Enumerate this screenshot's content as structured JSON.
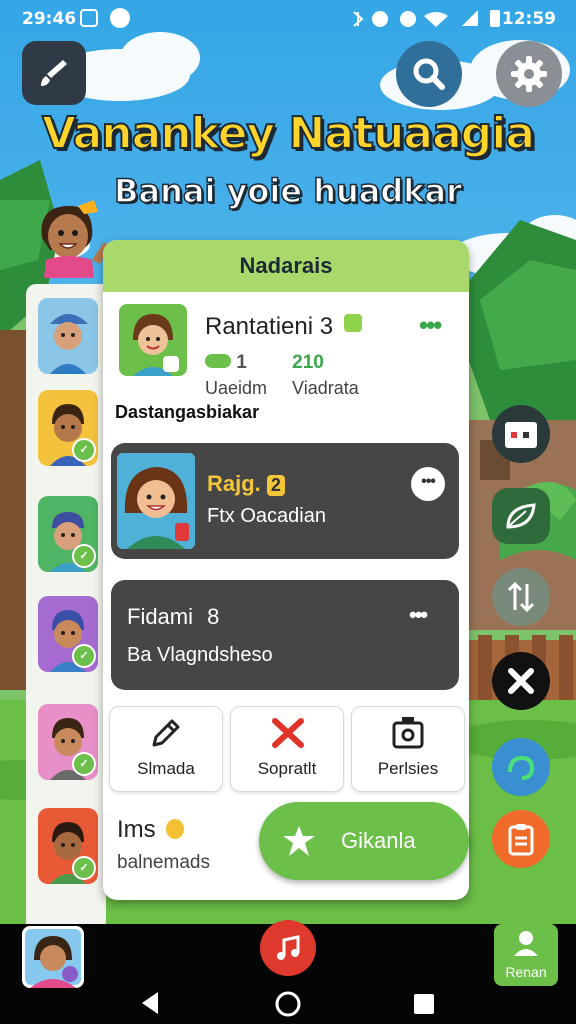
{
  "status_bar": {
    "time": "29:46",
    "clock": "12:59"
  },
  "header": {
    "title": "Vanankey Natuaagia",
    "subtitle": "Banai yoie huadkar"
  },
  "panel": {
    "header": "Nadarais",
    "profile": {
      "name": "Rantatieni 3",
      "stat_a_value": "1",
      "stat_b_value": "210",
      "stat_a_label": "Uaeidm",
      "stat_b_label": "Viadrata",
      "more": "•••"
    },
    "section_label": "Dastangasbiakar",
    "card1": {
      "title": "Rajg.",
      "badge": "2",
      "subtitle": "Ftx Oacadian",
      "more": "•••"
    },
    "card2": {
      "title": "Fidami",
      "badge": "8",
      "subtitle": "Ba Vlagndsheso",
      "more": "•••"
    },
    "actions": [
      {
        "label": "Slmada",
        "icon": "pencil-icon"
      },
      {
        "label": "Sopratlt",
        "icon": "x-mark-icon"
      },
      {
        "label": "Perlsies",
        "icon": "camera-icon"
      }
    ],
    "footer": {
      "title": "Ims",
      "subtitle": "balnemads",
      "cta_label": "Gikanla"
    }
  },
  "bottom_bar": {
    "profile_label": "Renan"
  },
  "colors": {
    "accent_green": "#6cc04a",
    "panel_header": "#a8d96a",
    "dark_card": "#464646",
    "title_yellow": "#ffd52b",
    "fab_red": "#e03a2e"
  }
}
